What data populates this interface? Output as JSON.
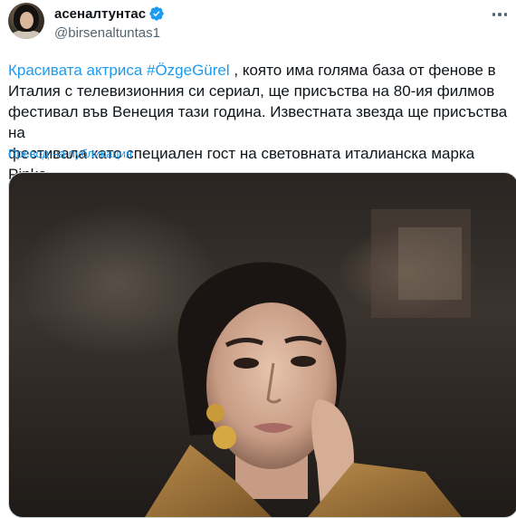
{
  "tweet": {
    "display_name": "асеналтунтас",
    "handle": "@birsenaltuntas1",
    "verified": true,
    "text_lines": [
      {
        "prefix": "",
        "link": "Красивата актриса #ÖzgeGürel",
        "suffix": " , която има голяма база от фенове в"
      },
      {
        "text": "Италия с телевизионния си сериал, ще присъства на 80-ия филмов"
      },
      {
        "text": "фестивал във Венеция тази година. Известната звезда ще присъства на"
      },
      {
        "text": "фестивала като специален гост на световната италианска марка Pinko."
      }
    ],
    "translate_label": "Превод на публикация"
  },
  "icons": {
    "verified": "verified-badge-icon",
    "more": "more-options-icon"
  },
  "colors": {
    "accent": "#1d9bf0",
    "text": "#0f1419",
    "secondary": "#536471"
  }
}
